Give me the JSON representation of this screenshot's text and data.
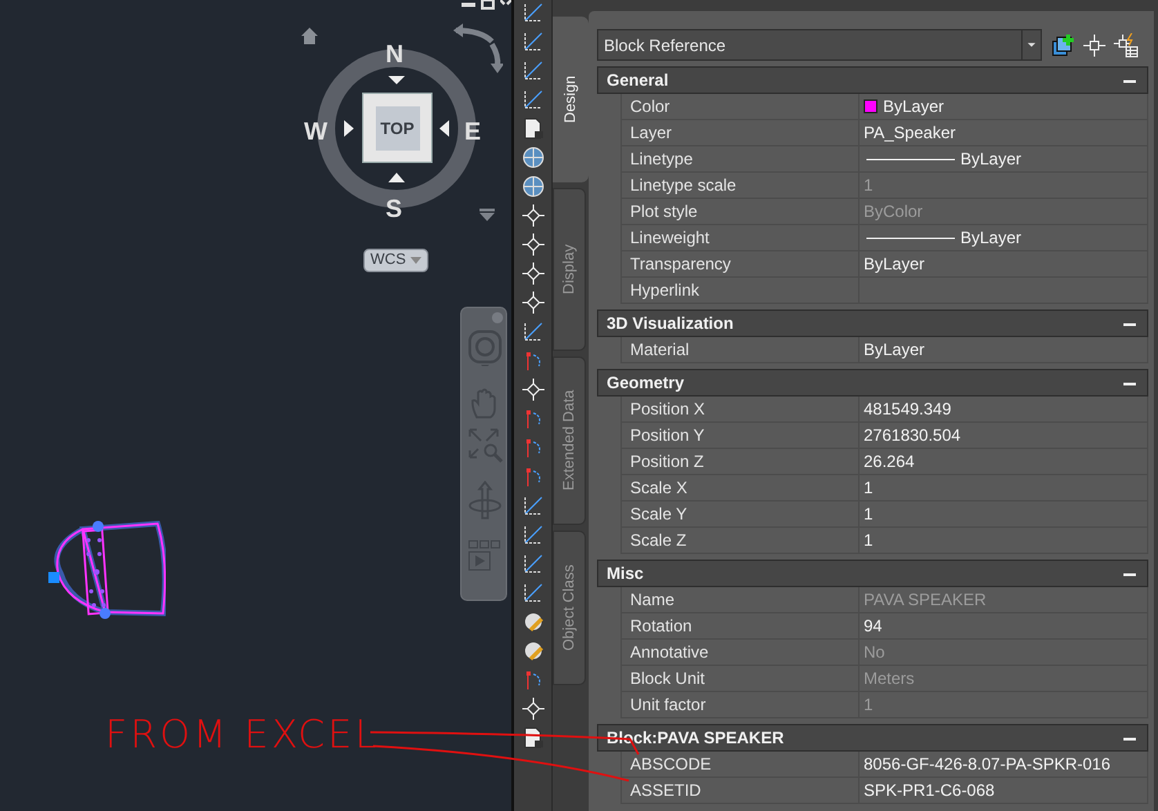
{
  "viewcube": {
    "north": "N",
    "south": "S",
    "east": "E",
    "west": "W",
    "face": "TOP",
    "coordinate_system": "WCS"
  },
  "annotation": {
    "text": "FROM EXCEL"
  },
  "side_tabs": [
    {
      "label": "Design",
      "selected": true
    },
    {
      "label": "Display",
      "selected": false
    },
    {
      "label": "Extended Data",
      "selected": false
    },
    {
      "label": "Object Class",
      "selected": false
    }
  ],
  "properties": {
    "object_type": "Block Reference",
    "sections": [
      {
        "title": "General",
        "expanded": true,
        "rows": [
          {
            "label": "Color",
            "value": "ByLayer",
            "kind": "color",
            "color": "#ff00ff",
            "disabled": false
          },
          {
            "label": "Layer",
            "value": "PA_Speaker",
            "kind": "text",
            "disabled": false
          },
          {
            "label": "Linetype",
            "value": "ByLayer",
            "kind": "line",
            "disabled": false
          },
          {
            "label": "Linetype scale",
            "value": "1",
            "kind": "text",
            "disabled": true
          },
          {
            "label": "Plot style",
            "value": "ByColor",
            "kind": "text",
            "disabled": true
          },
          {
            "label": "Lineweight",
            "value": "ByLayer",
            "kind": "line",
            "disabled": false
          },
          {
            "label": "Transparency",
            "value": "ByLayer",
            "kind": "text",
            "disabled": false
          },
          {
            "label": "Hyperlink",
            "kind": "text",
            "disabled": false
          }
        ]
      },
      {
        "title": "3D Visualization",
        "expanded": true,
        "rows": [
          {
            "label": "Material",
            "value": "ByLayer",
            "kind": "text",
            "disabled": false
          }
        ]
      },
      {
        "title": "Geometry",
        "expanded": true,
        "rows": [
          {
            "label": "Position X",
            "value": "481549.349",
            "kind": "text",
            "disabled": false
          },
          {
            "label": "Position Y",
            "value": "2761830.504",
            "kind": "text",
            "disabled": false
          },
          {
            "label": "Position Z",
            "value": "26.264",
            "kind": "text",
            "disabled": false
          },
          {
            "label": "Scale X",
            "value": "1",
            "kind": "text",
            "disabled": false
          },
          {
            "label": "Scale Y",
            "value": "1",
            "kind": "text",
            "disabled": false
          },
          {
            "label": "Scale Z",
            "value": "1",
            "kind": "text",
            "disabled": false
          }
        ]
      },
      {
        "title": "Misc",
        "expanded": true,
        "rows": [
          {
            "label": "Name",
            "value": "PAVA SPEAKER",
            "kind": "text",
            "disabled": true
          },
          {
            "label": "Rotation",
            "value": "94",
            "kind": "text",
            "disabled": false
          },
          {
            "label": "Annotative",
            "value": "No",
            "kind": "text",
            "disabled": true
          },
          {
            "label": "Block Unit",
            "value": "Meters",
            "kind": "text",
            "disabled": true
          },
          {
            "label": "Unit factor",
            "value": "1",
            "kind": "text",
            "disabled": true
          }
        ]
      },
      {
        "title": "Block:PAVA SPEAKER",
        "expanded": true,
        "rows": [
          {
            "label": "ABSCODE",
            "value": "8056-GF-426-8.07-PA-SPKR-016",
            "kind": "text",
            "disabled": false
          },
          {
            "label": "ASSETID",
            "value": "SPK-PR1-C6-068",
            "kind": "text",
            "disabled": false
          }
        ]
      }
    ]
  }
}
